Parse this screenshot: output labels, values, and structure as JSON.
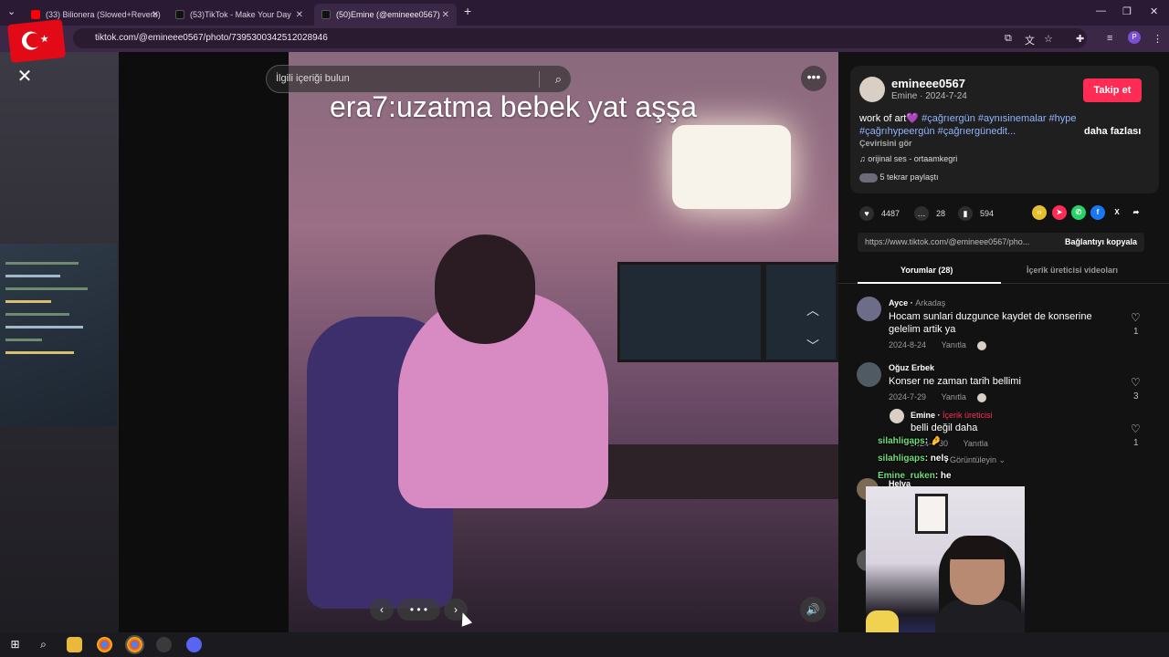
{
  "browser": {
    "tabs": [
      {
        "label": "(33) Bilionera (Slowed+Reverb)",
        "active": false,
        "icon": "youtube-icon"
      },
      {
        "label": "(53)TikTok - Make Your Day",
        "active": false,
        "icon": "tiktok-icon"
      },
      {
        "label": "(50)Emine (@emineee0567)",
        "active": true,
        "icon": "tiktok-icon"
      }
    ],
    "url": "tiktok.com/@emineee0567/photo/7395300342512028946",
    "profile_initial": "P",
    "accent": "#2b1a33"
  },
  "viewer": {
    "search_placeholder": "İlgili içeriği bulun",
    "caption": "era7:uzatma bebek yat aşşa"
  },
  "post": {
    "username": "emineee0567",
    "display_name": "Emine",
    "date": "2024-7-24",
    "follow_label": "Takip et",
    "description_prefix": "work of art",
    "emoji": "💜",
    "hashtags": "#çağrıergün #aynısinemalar #hype #çağrıhypeergün #çağrıergünedit...",
    "see_more": "daha fazlası",
    "translate": "Çevirisini gör",
    "sound": "orijinal ses - ortaamkegri",
    "reposts": "5 tekrar paylaştı",
    "likes": "4487",
    "comments": "28",
    "saves": "594",
    "link": "https://www.tiktok.com/@emineee0567/pho...",
    "copy_link": "Bağlantıyı kopyala",
    "accent": "#fe2c55"
  },
  "tabs": {
    "comments": "Yorumlar (28)",
    "creator_videos": "İçerik üreticisi videoları"
  },
  "comments": [
    {
      "name": "Ayce",
      "tag": "Arkadaş",
      "text": "Hocam sunlari duzgunce kaydet de konserine gelelim artik ya",
      "date": "2024-8-24",
      "reply": "Yanıtla",
      "likes": "1"
    },
    {
      "name": "Oğuz Erbek",
      "tag": "",
      "text": "Konser ne zaman tarih bellimi",
      "date": "2024-7-29",
      "reply": "Yanıtla",
      "likes": "3"
    },
    {
      "name": "Emine",
      "tag": "İçerik üreticisi",
      "text": "belli değil daha",
      "date": "2024-7-30",
      "reply": "Yanıtla",
      "likes": "1"
    }
  ],
  "more_replies": "Görüntüleyin",
  "partial_name": "Helva",
  "chat": [
    {
      "user": "silahligaps",
      "msg": ": "
    },
    {
      "user": "silahligaps",
      "msg": ": nelş"
    },
    {
      "user": "Emine_ruken",
      "msg": ": he"
    }
  ]
}
